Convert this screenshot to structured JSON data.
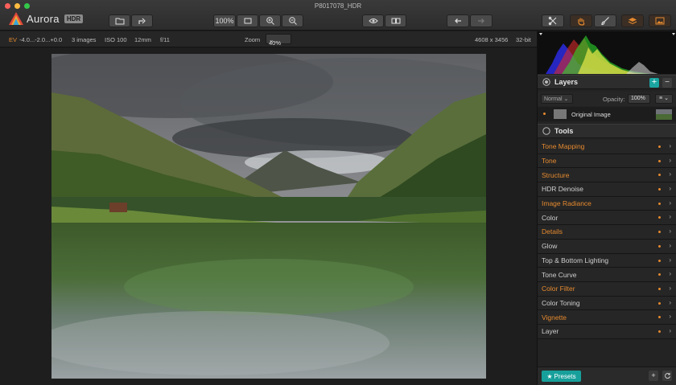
{
  "window": {
    "title": "P8017078_HDR"
  },
  "app": {
    "name": "Aurora",
    "badge": "HDR"
  },
  "toolbar": {
    "zoom_100_label": "100%",
    "buttons": [
      "open-icon",
      "share-icon",
      "fit-icon",
      "zoom-in-icon",
      "zoom-out-icon",
      "eye-icon",
      "compare-icon",
      "undo-icon",
      "redo-icon",
      "crop-icon",
      "hand-icon",
      "brush-icon",
      "layers-icon",
      "image-icon"
    ]
  },
  "infobar": {
    "ev_label": "EV",
    "ev_values": "-4.0...-2.0...+0.0",
    "images": "3 images",
    "iso": "ISO 100",
    "focal": "12mm",
    "aperture": "f/11",
    "zoom_label": "Zoom",
    "zoom_value": "40%",
    "dimensions": "4608 x 3456",
    "bit_depth": "32-bit"
  },
  "layers": {
    "title": "Layers",
    "add_label": "+",
    "remove_label": "−",
    "blend_mode": "Normal",
    "opacity_label": "Opacity:",
    "opacity_value": "100%",
    "items": [
      {
        "name": "Original Image"
      }
    ]
  },
  "tools": {
    "title": "Tools",
    "items": [
      {
        "name": "Tone Mapping",
        "active": true
      },
      {
        "name": "Tone",
        "active": true
      },
      {
        "name": "Structure",
        "active": true
      },
      {
        "name": "HDR Denoise",
        "active": false
      },
      {
        "name": "Image Radiance",
        "active": true
      },
      {
        "name": "Color",
        "active": false
      },
      {
        "name": "Details",
        "active": true
      },
      {
        "name": "Glow",
        "active": false
      },
      {
        "name": "Top & Bottom Lighting",
        "active": false
      },
      {
        "name": "Tone Curve",
        "active": false
      },
      {
        "name": "Color Filter",
        "active": true
      },
      {
        "name": "Color Toning",
        "active": false
      },
      {
        "name": "Vignette",
        "active": true
      },
      {
        "name": "Layer",
        "active": false
      }
    ]
  },
  "bottom": {
    "presets_label": "Presets"
  },
  "colors": {
    "accent_orange": "#e58a2f",
    "accent_teal": "#1aa5a0"
  }
}
